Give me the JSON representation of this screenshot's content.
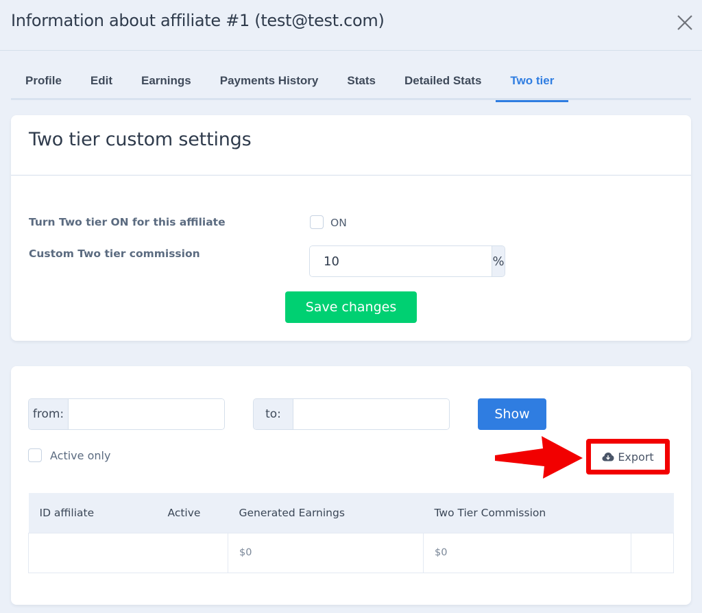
{
  "modal": {
    "title": "Information about affiliate #1 (test@test.com)",
    "close_icon": "close-icon"
  },
  "tabs": [
    {
      "label": "Profile",
      "active": false
    },
    {
      "label": "Edit",
      "active": false
    },
    {
      "label": "Earnings",
      "active": false
    },
    {
      "label": "Payments History",
      "active": false
    },
    {
      "label": "Stats",
      "active": false
    },
    {
      "label": "Detailed Stats",
      "active": false
    },
    {
      "label": "Two tier",
      "active": true
    }
  ],
  "settings": {
    "title": "Two tier custom settings",
    "toggle_label": "Turn Two tier ON for this affiliate",
    "toggle_checkbox_label": "ON",
    "toggle_checked": false,
    "commission_label": "Custom Two tier commission",
    "commission_value": "10",
    "commission_suffix": "%",
    "save_label": "Save changes"
  },
  "report": {
    "from_label": "from:",
    "from_value": "",
    "to_label": "to:",
    "to_value": "",
    "show_label": "Show",
    "active_only_label": "Active only",
    "active_only_checked": false,
    "export_label": "Export",
    "export_icon": "cloud-download-icon",
    "columns": [
      "ID affiliate",
      "Active",
      "Generated Earnings",
      "Two Tier Commission",
      ""
    ],
    "rows": [
      [
        "",
        "",
        "$0",
        "$0",
        ""
      ]
    ]
  },
  "annotation": {
    "arrow_color": "#f20000",
    "highlight_color": "#f20000"
  },
  "colors": {
    "accent": "#2f7de1",
    "success": "#00d072",
    "background": "#ebf0f8"
  }
}
